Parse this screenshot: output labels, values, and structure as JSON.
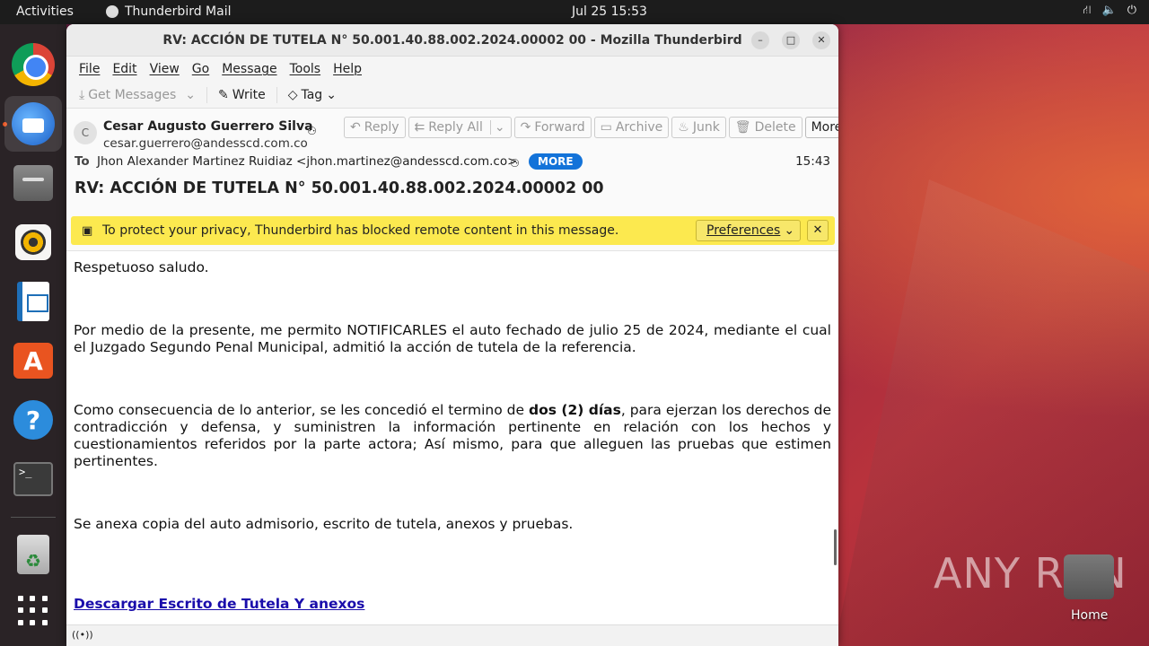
{
  "topbar": {
    "activities": "Activities",
    "app_name": "Thunderbird Mail",
    "clock": "Jul 25  15:53",
    "tray_icons": [
      "network-icon",
      "volume-icon",
      "power-icon"
    ]
  },
  "dock": {
    "items": [
      "chrome-icon",
      "thunderbird-icon",
      "files-icon",
      "rhythmbox-icon",
      "writer-icon",
      "app-center-icon",
      "help-icon",
      "terminal-icon",
      "trash-icon",
      "show-apps-icon"
    ],
    "terminal_glyph": ">_",
    "store_glyph": "A",
    "help_glyph": "?"
  },
  "desktop": {
    "home_label": "Home",
    "watermark": "ANY RUN"
  },
  "window": {
    "title": "RV: ACCIÓN DE TUTELA N° 50.001.40.88.002.2024.00002 00 - Mozilla Thunderbird",
    "controls": [
      "–",
      "□",
      "✕"
    ]
  },
  "menu": {
    "file": "File",
    "edit": "Edit",
    "view": "View",
    "go": "Go",
    "message": "Message",
    "tools": "Tools",
    "help": "Help"
  },
  "toolbar": {
    "get_messages": "Get Messages",
    "write": "Write",
    "tag": "Tag"
  },
  "header": {
    "avatar_initial": "C",
    "from_name": "Cesar Augusto Guerrero Silva",
    "from_email": "cesar.guerrero@andesscd.com.co",
    "buttons": {
      "reply": "Reply",
      "reply_all": "Reply All",
      "forward": "Forward",
      "archive": "Archive",
      "junk": "Junk",
      "delete": "Delete",
      "more": "More"
    },
    "to_label": "To",
    "to_value": "Jhon Alexander Martinez Ruidiaz <jhon.martinez@andesscd.com.co>",
    "more_badge": "MORE",
    "time": "15:43",
    "subject": "RV: ACCIÓN DE TUTELA N° 50.001.40.88.002.2024.00002 00"
  },
  "notice": {
    "text": "To protect your privacy, Thunderbird has blocked remote content in this message.",
    "preferences_label": "Preferences",
    "close": "✕"
  },
  "message": {
    "greeting": "Respetuoso saludo.",
    "p1": "Por medio de la presente, me permito NOTIFICARLES el auto fechado de julio 25 de 2024, mediante el cual el Juzgado Segundo Penal Municipal, admitió la acción de tutela de la referencia.",
    "p2_before": "Como consecuencia de lo anterior, se les concedió el termino de ",
    "p2_bold": "dos (2) días",
    "p2_after": ", para ejerzan los derechos de contradicción y defensa, y suministren la información pertinente en relación con los hechos y cuestionamientos referidos por la parte actora; Así mismo, para que alleguen las pruebas que estimen pertinentes.",
    "p3": "Se anexa copia del auto admisorio, escrito de tutela, anexos y pruebas.",
    "link": "Descargar Escrito de Tutela Y anexos"
  },
  "statusbar": {
    "icon": "((•))"
  }
}
